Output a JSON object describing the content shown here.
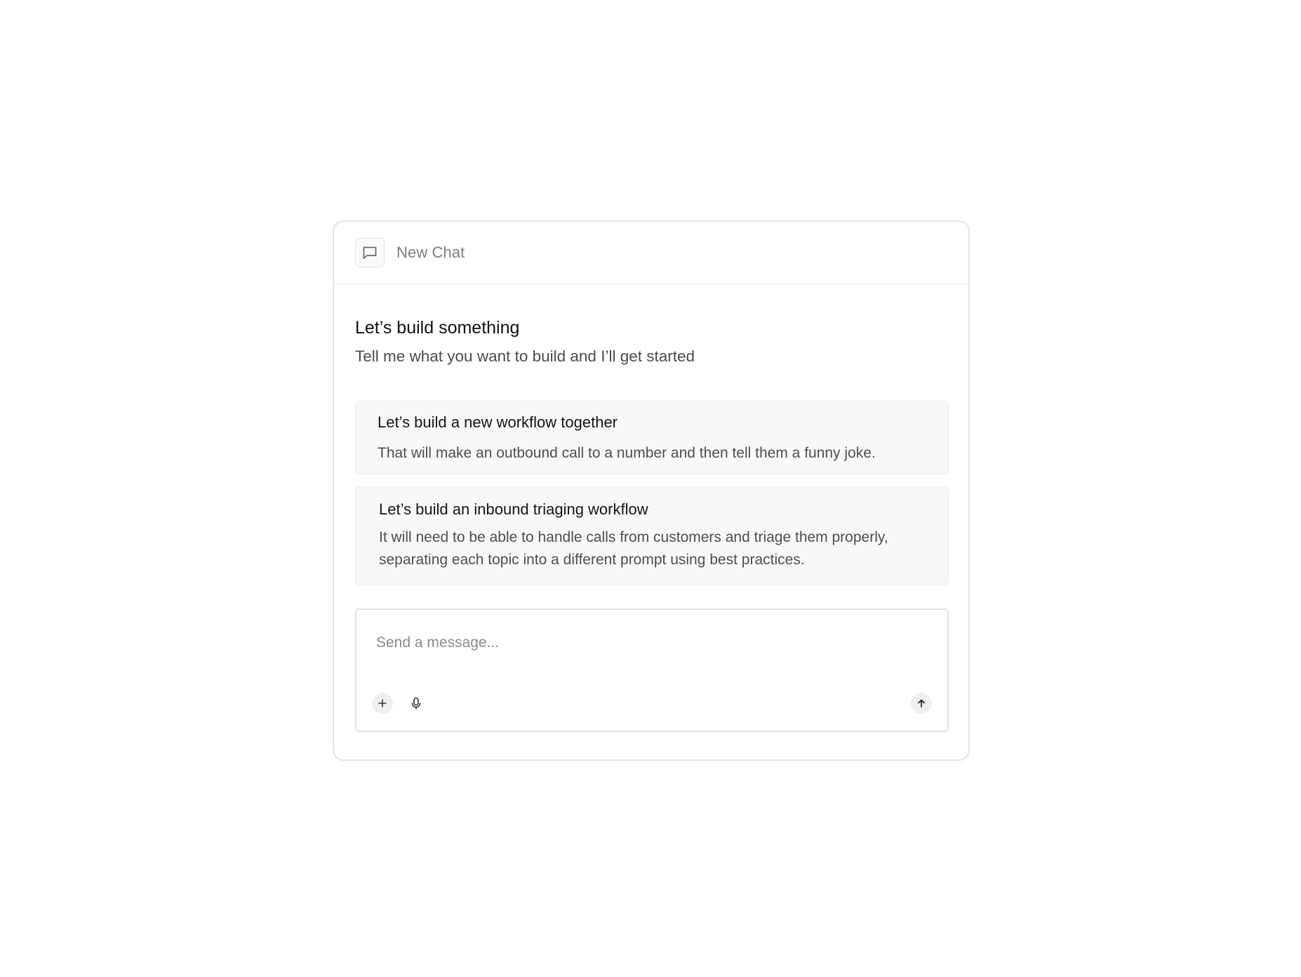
{
  "header": {
    "icon": "chat-bubble-icon",
    "title": "New Chat"
  },
  "greeting": {
    "title": "Let’s build something",
    "subtitle": "Tell me what you want to build and I’ll get started"
  },
  "suggestions": [
    {
      "title": "Let’s build a new workflow together",
      "text": "That will make an outbound call to a number and then tell them a funny joke."
    },
    {
      "title": "Let’s build an inbound triaging workflow",
      "text": "It will need to be able to handle calls from customers and triage them properly, separating each topic into a different prompt using best practices."
    }
  ],
  "composer": {
    "placeholder": "Send a message...",
    "value": "",
    "add_icon": "plus-icon",
    "mic_icon": "microphone-icon",
    "send_icon": "arrow-up-icon"
  },
  "colors": {
    "border": "#e4e4e4",
    "card_background": "#f8f8f8",
    "muted_text": "#7d7d7d"
  }
}
